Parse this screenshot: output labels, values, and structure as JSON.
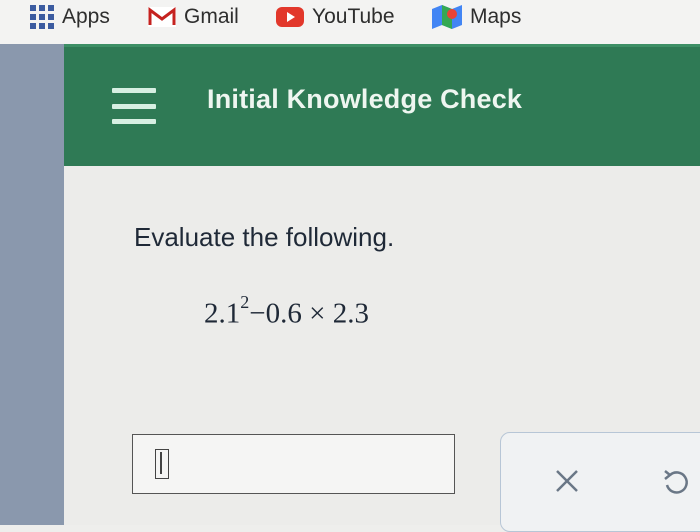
{
  "bookmarks": [
    {
      "label": "Apps",
      "icon": "apps-grid-icon"
    },
    {
      "label": "Gmail",
      "icon": "gmail-icon"
    },
    {
      "label": "YouTube",
      "icon": "youtube-icon"
    },
    {
      "label": "Maps",
      "icon": "maps-icon"
    }
  ],
  "header": {
    "title": "Initial Knowledge Check",
    "menu_icon": "hamburger-menu-icon",
    "background": "#2f7a55"
  },
  "question": {
    "prompt": "Evaluate the following.",
    "expression": {
      "base": "2.1",
      "exponent": "2",
      "rest": "−0.6 × 2.3"
    }
  },
  "answer": {
    "value": "",
    "cursor_icon": "text-cursor-icon"
  },
  "actions": {
    "clear_icon": "x-icon",
    "undo_icon": "undo-icon"
  }
}
